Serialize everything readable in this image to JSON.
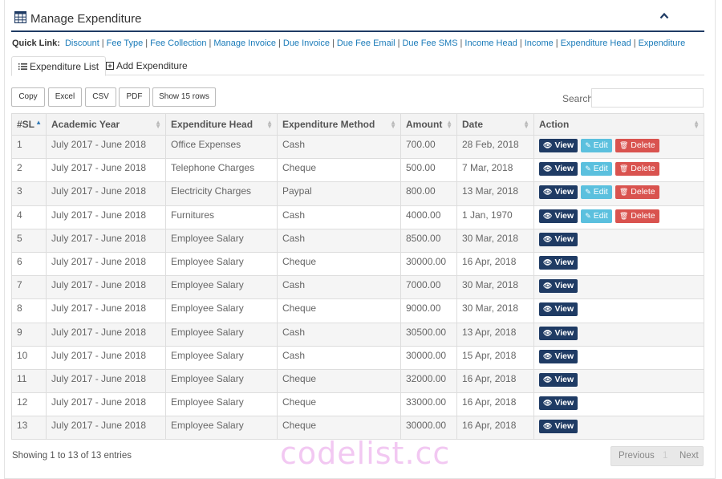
{
  "header": {
    "title": "Manage Expenditure"
  },
  "quicklinks": {
    "label": "Quick Link:",
    "links": [
      "Discount",
      "Fee Type",
      "Fee Collection",
      "Manage Invoice",
      "Due Invoice",
      "Due Fee Email",
      "Due Fee SMS",
      "Income Head",
      "Income",
      "Expenditure Head",
      "Expenditure"
    ]
  },
  "tabs": [
    {
      "label": "Expenditure List",
      "icon": "list-icon"
    },
    {
      "label": "Add Expenditure",
      "icon": "plus-square-icon"
    }
  ],
  "export_buttons": [
    "Copy",
    "Excel",
    "CSV",
    "PDF",
    "Show 15 rows"
  ],
  "search": {
    "label": "Search:",
    "value": ""
  },
  "table": {
    "columns": [
      "#SL",
      "Academic Year",
      "Expenditure Head",
      "Expenditure Method",
      "Amount",
      "Date",
      "Action"
    ],
    "action_labels": {
      "view": "View",
      "edit": "Edit",
      "delete": "Delete"
    },
    "rows": [
      {
        "sl": "1",
        "year": "July 2017 - June 2018",
        "head": "Office Expenses",
        "method": "Cash",
        "amount": "700.00",
        "date": "28 Feb, 2018",
        "editable": true
      },
      {
        "sl": "2",
        "year": "July 2017 - June 2018",
        "head": "Telephone Charges",
        "method": "Cheque",
        "amount": "500.00",
        "date": "7 Mar, 2018",
        "editable": true
      },
      {
        "sl": "3",
        "year": "July 2017 - June 2018",
        "head": "Electricity Charges",
        "method": "Paypal",
        "amount": "800.00",
        "date": "13 Mar, 2018",
        "editable": true
      },
      {
        "sl": "4",
        "year": "July 2017 - June 2018",
        "head": "Furnitures",
        "method": "Cash",
        "amount": "4000.00",
        "date": "1 Jan, 1970",
        "editable": true
      },
      {
        "sl": "5",
        "year": "July 2017 - June 2018",
        "head": "Employee Salary",
        "method": "Cash",
        "amount": "8500.00",
        "date": "30 Mar, 2018",
        "editable": false
      },
      {
        "sl": "6",
        "year": "July 2017 - June 2018",
        "head": "Employee Salary",
        "method": "Cheque",
        "amount": "30000.00",
        "date": "16 Apr, 2018",
        "editable": false
      },
      {
        "sl": "7",
        "year": "July 2017 - June 2018",
        "head": "Employee Salary",
        "method": "Cash",
        "amount": "7000.00",
        "date": "30 Mar, 2018",
        "editable": false
      },
      {
        "sl": "8",
        "year": "July 2017 - June 2018",
        "head": "Employee Salary",
        "method": "Cheque",
        "amount": "9000.00",
        "date": "30 Mar, 2018",
        "editable": false
      },
      {
        "sl": "9",
        "year": "July 2017 - June 2018",
        "head": "Employee Salary",
        "method": "Cash",
        "amount": "30500.00",
        "date": "13 Apr, 2018",
        "editable": false
      },
      {
        "sl": "10",
        "year": "July 2017 - June 2018",
        "head": "Employee Salary",
        "method": "Cash",
        "amount": "30000.00",
        "date": "15 Apr, 2018",
        "editable": false
      },
      {
        "sl": "11",
        "year": "July 2017 - June 2018",
        "head": "Employee Salary",
        "method": "Cheque",
        "amount": "32000.00",
        "date": "16 Apr, 2018",
        "editable": false
      },
      {
        "sl": "12",
        "year": "July 2017 - June 2018",
        "head": "Employee Salary",
        "method": "Cheque",
        "amount": "33000.00",
        "date": "16 Apr, 2018",
        "editable": false
      },
      {
        "sl": "13",
        "year": "July 2017 - June 2018",
        "head": "Employee Salary",
        "method": "Cheque",
        "amount": "30000.00",
        "date": "16 Apr, 2018",
        "editable": false
      }
    ]
  },
  "footer": {
    "info": "Showing 1 to 13 of 13 entries",
    "previous": "Previous",
    "page": "1",
    "next": "Next"
  },
  "watermark": "codelist.cc",
  "colors": {
    "primary": "#1f3b64",
    "link": "#1a7bb9",
    "edit": "#5bc0de",
    "delete": "#d9534f"
  }
}
